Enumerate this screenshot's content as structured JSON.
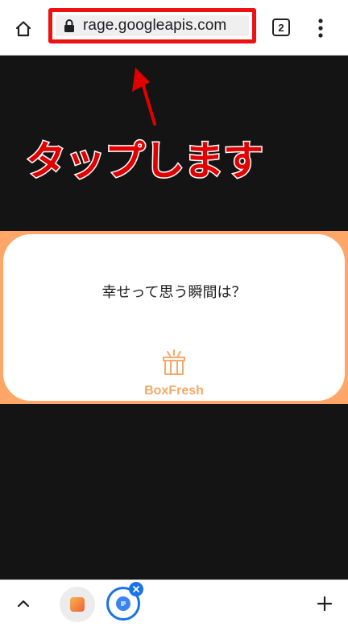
{
  "browser": {
    "url": "rage.googleapis.com",
    "tab_count": "2"
  },
  "annotation": {
    "text": "タップします",
    "color": "#e10000"
  },
  "content": {
    "question": "幸せって思う瞬間は？",
    "brand_name": "BoxFresh",
    "brand_color": "#f3a968",
    "band_color": "#ffa668"
  },
  "icons": {
    "home": "home-icon",
    "lock": "lock-icon",
    "menu": "more-vert-icon",
    "collapse": "chevron-up-icon",
    "new_tab": "plus-icon",
    "brand": "gift-box-icon"
  },
  "accent_color": "#1a73e8"
}
